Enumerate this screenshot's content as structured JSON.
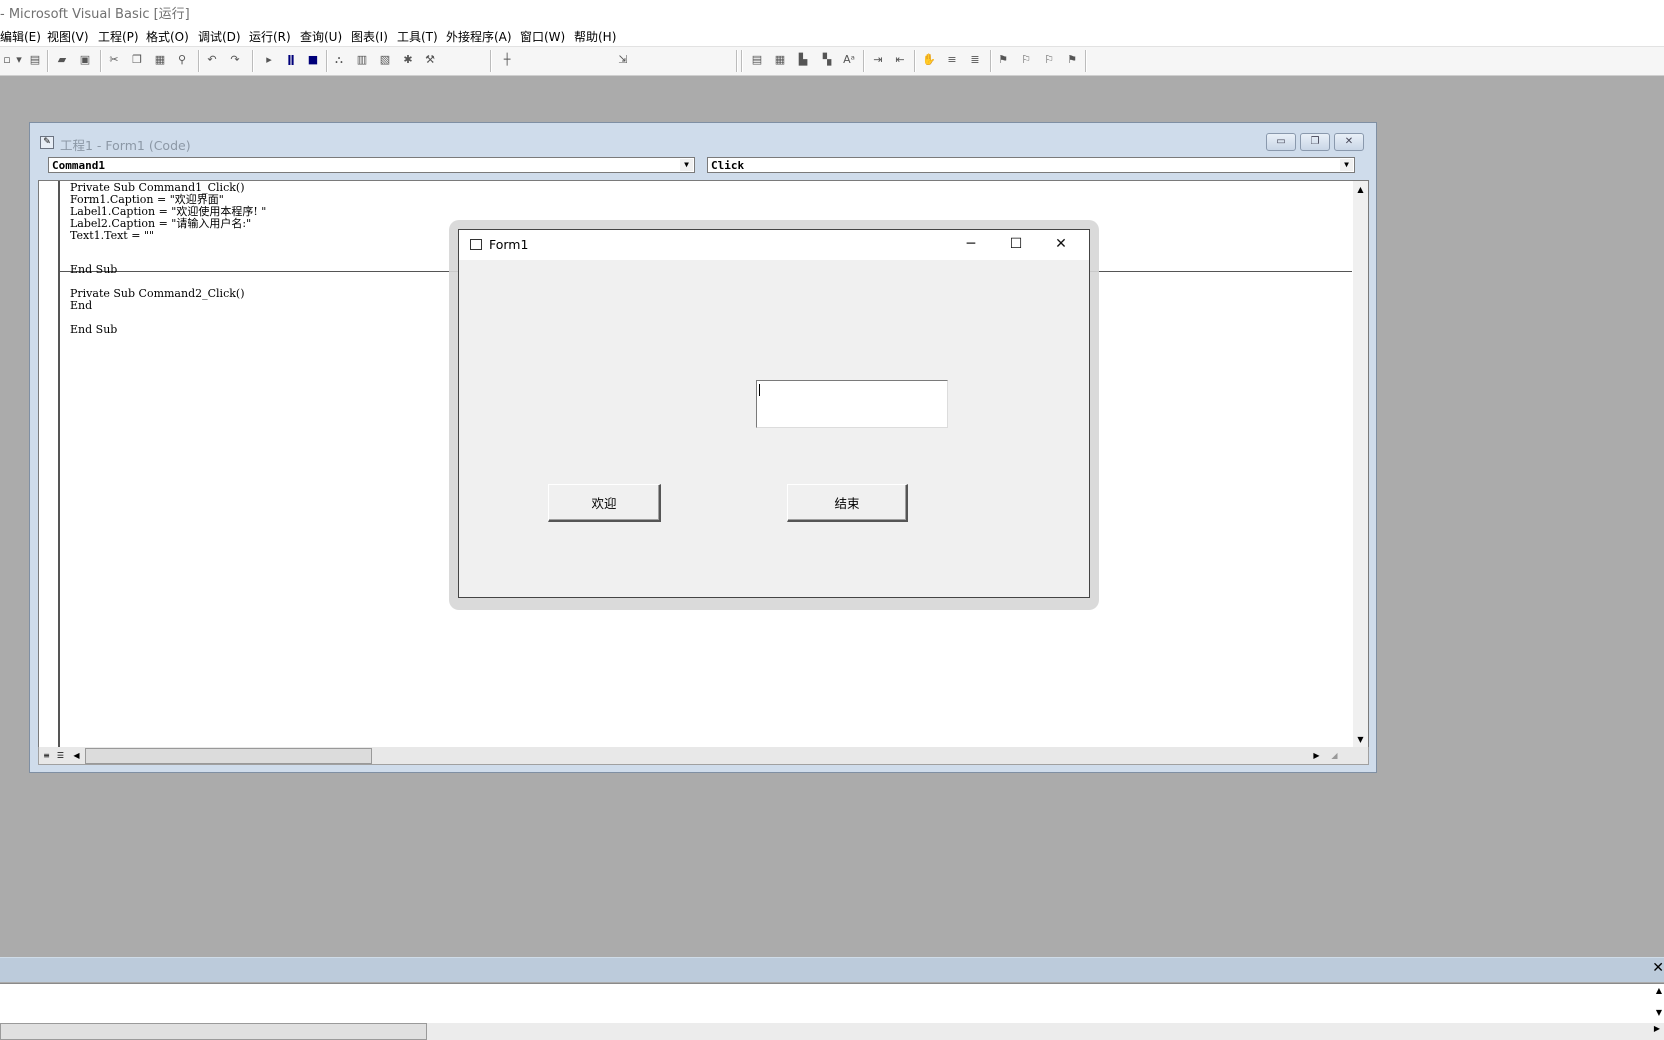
{
  "app": {
    "title": "- Microsoft Visual Basic [运行]"
  },
  "menu": [
    {
      "label": "编辑(E)"
    },
    {
      "label": "视图(V)"
    },
    {
      "label": "工程(P)"
    },
    {
      "label": "格式(O)"
    },
    {
      "label": "调试(D)"
    },
    {
      "label": "运行(R)"
    },
    {
      "label": "查询(U)"
    },
    {
      "label": "图表(I)"
    },
    {
      "label": "工具(T)"
    },
    {
      "label": "外接程序(A)"
    },
    {
      "label": "窗口(W)"
    },
    {
      "label": "帮助(H)"
    }
  ],
  "toolbar_icons": [
    "add-form-icon",
    "add-module-icon",
    "open-icon",
    "save-icon",
    "cut-icon",
    "copy-icon",
    "paste-icon",
    "find-icon",
    "undo-icon",
    "redo-icon",
    "start-icon",
    "break-icon",
    "end-icon",
    "project-explorer-icon",
    "properties-icon",
    "form-layout-icon",
    "object-browser-icon",
    "toolbox-icon",
    "position-icon",
    "size-icon"
  ],
  "code_window": {
    "caption": "工程1 - Form1 (Code)",
    "object_combo": "Command1",
    "procedure_combo": "Click",
    "code_lines": [
      "Private Sub Command1_Click()",
      "Form1.Caption = \"欢迎界面\"",
      "Label1.Caption = \"欢迎使用本程序! \"",
      "Label2.Caption = \"请输入用户名:\"",
      "Text1.Text = \"\"",
      "",
      "End Sub",
      "",
      "Private Sub Command2_Click()",
      "End",
      "",
      "End Sub"
    ]
  },
  "form1": {
    "title": "Form1",
    "textbox_value": "",
    "button_welcome": "欢迎",
    "button_end": "结束"
  }
}
